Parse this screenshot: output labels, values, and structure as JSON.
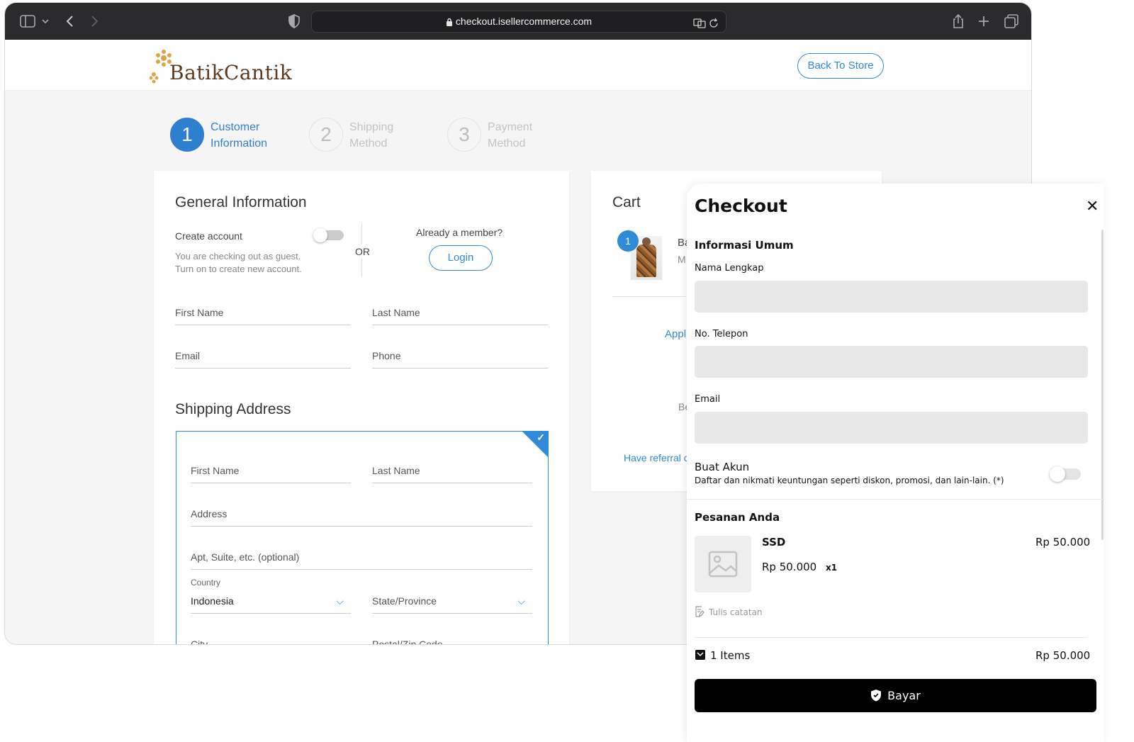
{
  "browser": {
    "url": "checkout.isellercommerce.com"
  },
  "header": {
    "logo_text": "BatikCantik",
    "back_button": "Back To Store"
  },
  "steps": [
    {
      "number": "1",
      "line1": "Customer",
      "line2": "Information"
    },
    {
      "number": "2",
      "line1": "Shipping",
      "line2": "Method"
    },
    {
      "number": "3",
      "line1": "Payment",
      "line2": "Method"
    }
  ],
  "general": {
    "title": "General Information",
    "create_account": "Create account",
    "guest_line1": "You are checking out as guest.",
    "guest_line2": "Turn on to create new account.",
    "or": "OR",
    "already_member": "Already a member?",
    "login": "Login",
    "first_name": "First Name",
    "last_name": "Last Name",
    "email": "Email",
    "phone": "Phone"
  },
  "shipping": {
    "title": "Shipping Address",
    "first_name": "First Name",
    "last_name": "Last Name",
    "address": "Address",
    "apt": "Apt, Suite, etc. (optional)",
    "country_label": "Country",
    "country_value": "Indonesia",
    "state": "State/Province",
    "city": "City",
    "postal": "Postal/Zip Code"
  },
  "cart": {
    "title": "Cart",
    "badge": "1",
    "item_initial": "Ba",
    "item_sub": "M",
    "apply_partial": "Appl",
    "b_partial": "Be",
    "referral_partial": "Have referral c"
  },
  "panel": {
    "title": "Checkout",
    "close": "✕",
    "general_title": "Informasi Umum",
    "name_label": "Nama Lengkap",
    "phone_label": "No. Telepon",
    "email_label": "Email",
    "account_title": "Buat Akun",
    "account_desc": "Daftar dan nikmati keuntungan seperti diskon, promosi, dan lain-lain. (*)",
    "order_title": "Pesanan Anda",
    "product_name": "SSD",
    "product_price": "Rp 50.000",
    "product_unit_price": "Rp 50.000",
    "product_qty": "x1",
    "note": "Tulis catatan",
    "items_count": "1 Items",
    "items_total": "Rp 50.000",
    "pay_button": "Bayar"
  }
}
